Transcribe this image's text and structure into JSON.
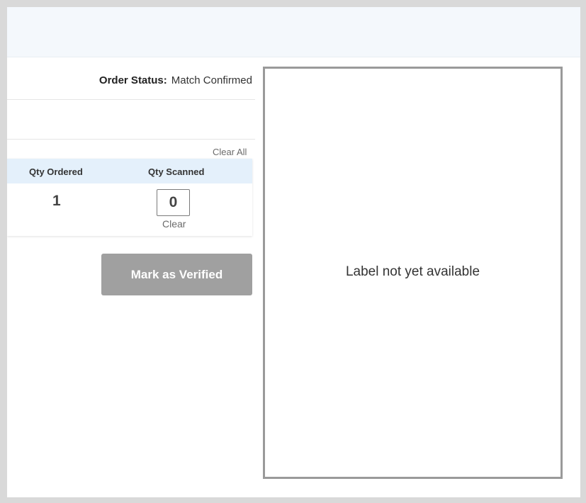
{
  "order": {
    "status_label": "Order Status:",
    "status_value": "Match Confirmed"
  },
  "table": {
    "clear_all": "Clear All",
    "columns": [
      "Qty Ordered",
      "Qty Scanned"
    ],
    "row": {
      "qty_ordered": "1",
      "qty_scanned": "0",
      "clear": "Clear"
    }
  },
  "actions": {
    "mark_verified": "Mark as Verified"
  },
  "label_panel": {
    "message": "Label not yet available"
  },
  "colors": {
    "header_band": "#f4f8fc",
    "table_header": "#e4f0fb",
    "button_disabled": "#a0a0a0",
    "frame": "#d9d9d9"
  }
}
